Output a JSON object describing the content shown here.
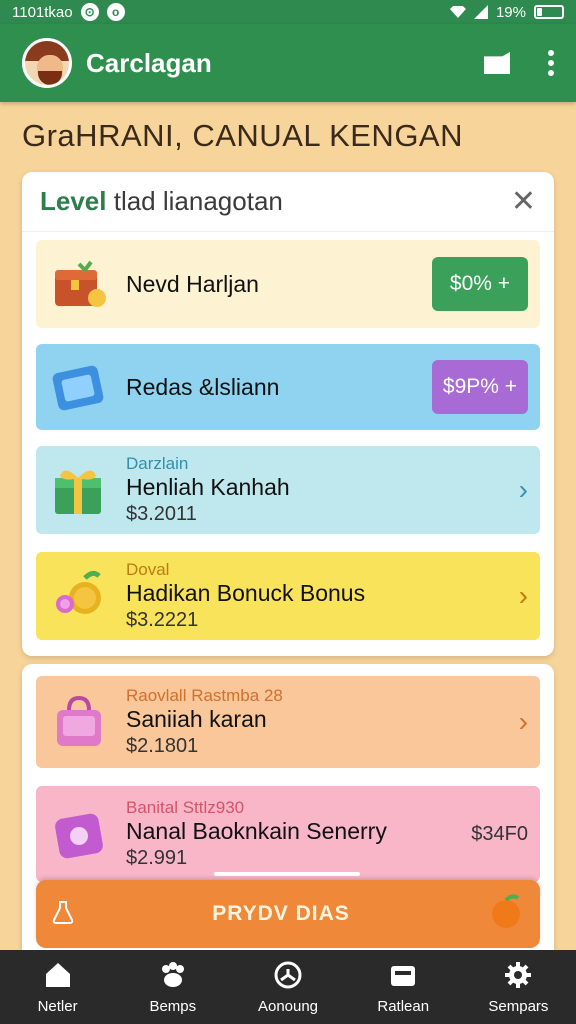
{
  "status_bar": {
    "time": "1101tkao",
    "notif": "o",
    "battery": "19%",
    "battery_level": 0.19
  },
  "app_bar": {
    "title": "Carclagan"
  },
  "headline": "GraHRANI, CANUAL KENGAN",
  "panel": {
    "title_accent": "Level",
    "title_rest": " tlad lianagotan",
    "rows": [
      {
        "small": "",
        "title": "Nevd Harljan",
        "price": "",
        "pill": "$0% +"
      },
      {
        "small": "",
        "title": "Redas &lsliann",
        "price": "",
        "pill": "$9P% +"
      },
      {
        "small": "Darzlain",
        "title": "Henliah Kanhah",
        "price": "$3.2011"
      },
      {
        "small": "Doval",
        "title": "Hadikan Bonuck Bonus",
        "price": "$3.2221"
      }
    ]
  },
  "panel2": {
    "rows": [
      {
        "small": "Raovlall Rastmba 28",
        "title": "Saniiah karan",
        "price": "$2.1801"
      },
      {
        "small": "Banital Sttlz930",
        "title": "Nanal Baoknkain Senerry",
        "price": "$2.991",
        "value": "$34F0"
      }
    ]
  },
  "cta": {
    "label": "PRYDV DIAS"
  },
  "bottom_nav": [
    {
      "label": "Netler",
      "icon": "home-icon"
    },
    {
      "label": "Bemps",
      "icon": "paw-icon"
    },
    {
      "label": "Aonoung",
      "icon": "steering-wheel-icon"
    },
    {
      "label": "Ratlean",
      "icon": "wallet-icon"
    },
    {
      "label": "Sempars",
      "icon": "gear-icon"
    }
  ],
  "colors": {
    "green": "#2f8f4f",
    "row1": "#fdf3d3",
    "row2": "#8fd3f0",
    "row3": "#bfe8ee",
    "row4": "#f8e35a",
    "row5": "#f9c79a",
    "row6": "#f8b6c8",
    "cta": "#f0883a"
  }
}
